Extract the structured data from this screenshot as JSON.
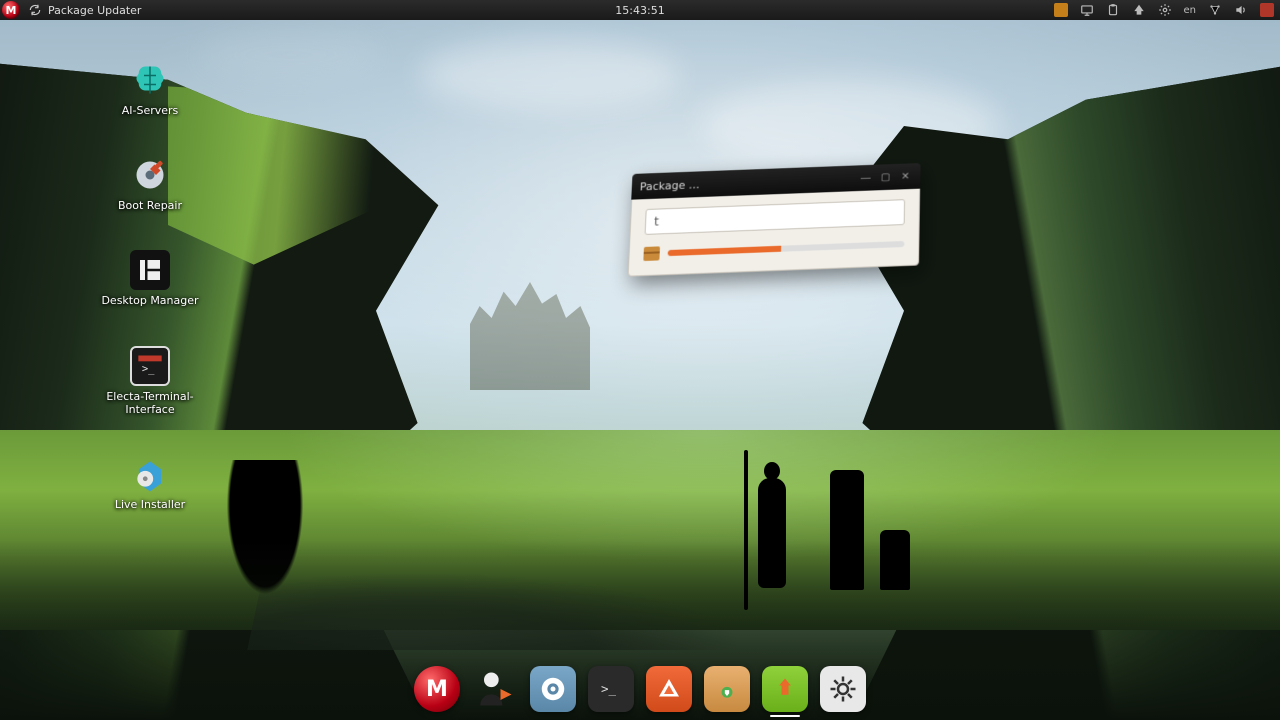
{
  "panel": {
    "app_title": "Package Updater",
    "clock": "15:43:51",
    "lang": "en"
  },
  "desktop_icons": [
    {
      "label": "AI-Servers"
    },
    {
      "label": "Boot Repair"
    },
    {
      "label": "Desktop Manager"
    },
    {
      "label": "Electa-Terminal-Interface"
    },
    {
      "label": "Live Installer"
    }
  ],
  "dialog": {
    "title": "Package …",
    "input_text": "t",
    "progress_percent": 48
  },
  "dock": [
    {
      "name": "menu"
    },
    {
      "name": "user-switch"
    },
    {
      "name": "chromium"
    },
    {
      "name": "terminal"
    },
    {
      "name": "software-center"
    },
    {
      "name": "installer"
    },
    {
      "name": "package-updater"
    },
    {
      "name": "settings"
    }
  ],
  "colors": {
    "accent": "#e96a2a",
    "panel": "#1a1a1a"
  }
}
